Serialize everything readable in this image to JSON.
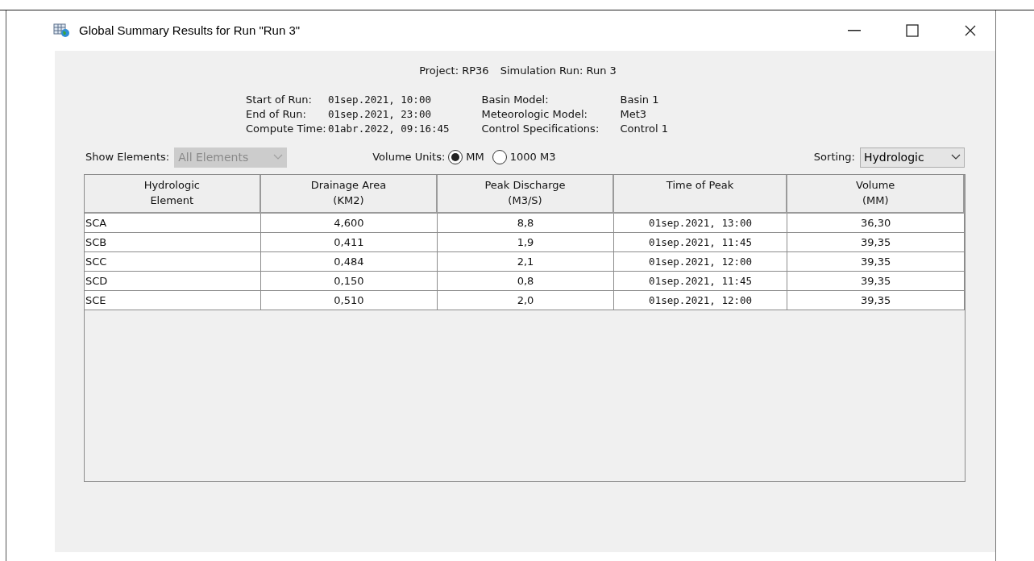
{
  "window": {
    "title": "Global Summary Results for Run \"Run 3\""
  },
  "header": {
    "project_label": "Project:",
    "project": "RP36",
    "run_label": "Simulation Run:",
    "run": "Run 3"
  },
  "info_left": [
    {
      "label": "Start of Run:",
      "value": "01sep.2021, 10:00"
    },
    {
      "label": "End of Run:",
      "value": "01sep.2021, 23:00"
    },
    {
      "label": "Compute Time:",
      "value": "01abr.2022, 09:16:45"
    }
  ],
  "info_right": [
    {
      "label": "Basin Model:",
      "value": "Basin 1"
    },
    {
      "label": "Meteorologic Model:",
      "value": "Met3"
    },
    {
      "label": "Control Specifications:",
      "value": "Control 1"
    }
  ],
  "show_elements": {
    "label": "Show Elements:",
    "value": "All Elements",
    "disabled": true
  },
  "volume_units": {
    "label": "Volume Units:",
    "options": [
      {
        "label": "MM",
        "selected": true
      },
      {
        "label": "1000 M3",
        "selected": false
      }
    ]
  },
  "sorting": {
    "label": "Sorting:",
    "value": "Hydrologic",
    "disabled": false
  },
  "table": {
    "columns": [
      "Hydrologic\nElement",
      "Drainage Area\n(KM2)",
      "Peak Discharge\n(M3/S)",
      "Time of Peak",
      "Volume\n(MM)"
    ],
    "rows": [
      [
        "SCA",
        "4,600",
        "8,8",
        "01sep.2021, 13:00",
        "36,30"
      ],
      [
        "SCB",
        "0,411",
        "1,9",
        "01sep.2021, 11:45",
        "39,35"
      ],
      [
        "SCC",
        "0,484",
        "2,1",
        "01sep.2021, 12:00",
        "39,35"
      ],
      [
        "SCD",
        "0,150",
        "0,8",
        "01sep.2021, 11:45",
        "39,35"
      ],
      [
        "SCE",
        "0,510",
        "2,0",
        "01sep.2021, 12:00",
        "39,35"
      ]
    ]
  }
}
